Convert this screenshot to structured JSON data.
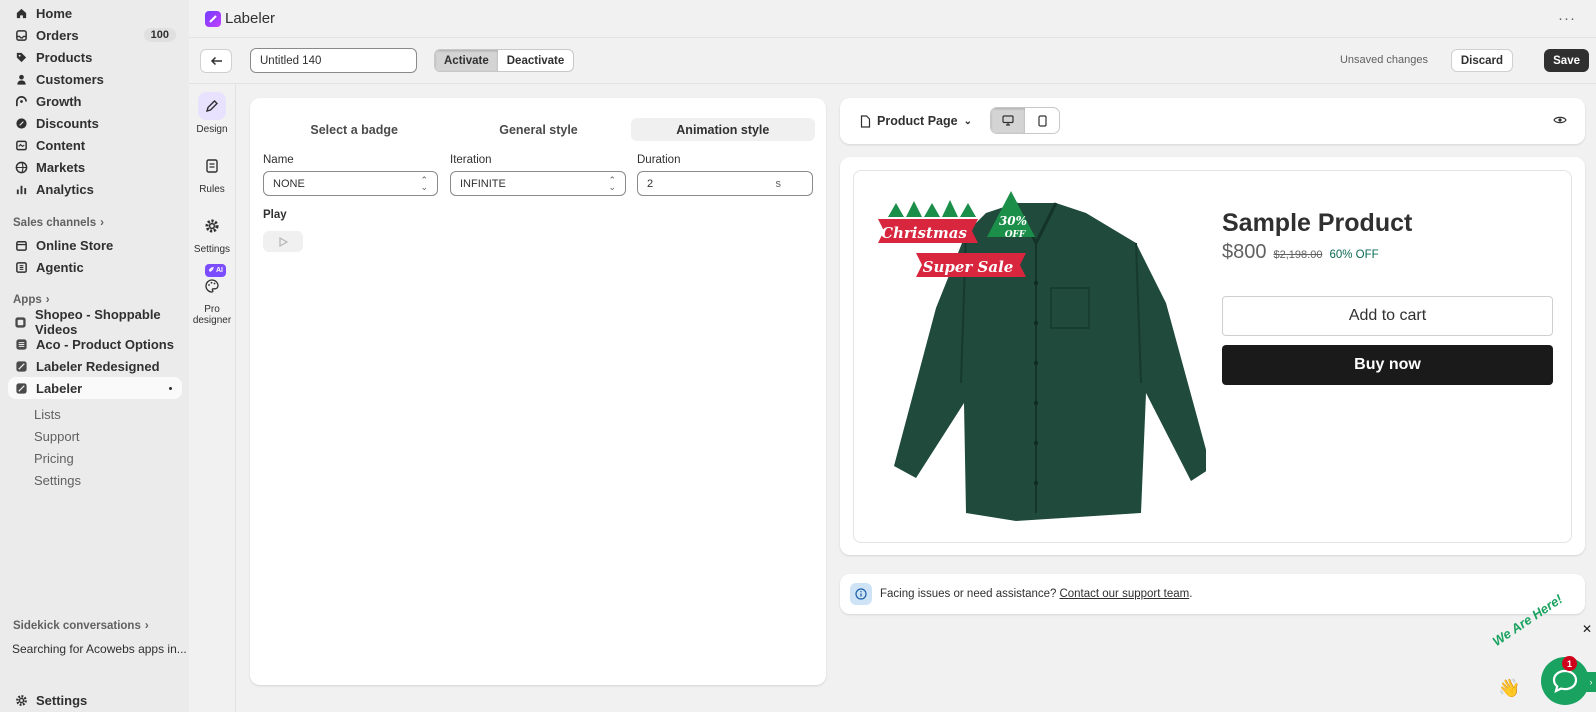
{
  "sidebar": {
    "items": [
      {
        "label": "Home",
        "icon": "home-icon"
      },
      {
        "label": "Orders",
        "icon": "inbox-icon",
        "badge": "100"
      },
      {
        "label": "Products",
        "icon": "tag-icon"
      },
      {
        "label": "Customers",
        "icon": "person-icon"
      },
      {
        "label": "Growth",
        "icon": "growth-icon"
      },
      {
        "label": "Discounts",
        "icon": "discount-icon"
      },
      {
        "label": "Content",
        "icon": "content-icon"
      },
      {
        "label": "Markets",
        "icon": "globe-icon"
      },
      {
        "label": "Analytics",
        "icon": "analytics-icon"
      }
    ],
    "sales_channels_title": "Sales channels",
    "sales_channels": [
      {
        "label": "Online Store",
        "icon": "store-icon"
      },
      {
        "label": "Agentic",
        "icon": "agentic-icon"
      }
    ],
    "apps_title": "Apps",
    "apps": [
      {
        "label": "Shopeo - Shoppable Videos",
        "icon": "app-icon"
      },
      {
        "label": "Aco - Product Options",
        "icon": "app-icon"
      },
      {
        "label": "Labeler Redesigned",
        "icon": "app-icon"
      },
      {
        "label": "Labeler",
        "icon": "labeler-icon"
      }
    ],
    "labeler_sub": [
      "Lists",
      "Support",
      "Pricing",
      "Settings"
    ],
    "sidekick_title": "Sidekick conversations",
    "sidekick_item": "Searching for Acowebs apps in...",
    "settings_label": "Settings"
  },
  "topbar": {
    "app_name": "Labeler"
  },
  "toolbar": {
    "title_value": "Untitled 140",
    "activate_label": "Activate",
    "deactivate_label": "Deactivate",
    "unsaved_text": "Unsaved changes",
    "discard_label": "Discard",
    "save_label": "Save"
  },
  "tools": [
    {
      "label": "Design",
      "icon": "pencil-icon"
    },
    {
      "label": "Rules",
      "icon": "scroll-icon"
    },
    {
      "label": "Settings",
      "icon": "gear-icon"
    },
    {
      "label": "Pro designer",
      "icon": "palette-icon",
      "tag": "AI"
    }
  ],
  "editor": {
    "tabs": [
      "Select a badge",
      "General style",
      "Animation style"
    ],
    "active_tab": "Animation style",
    "name_label": "Name",
    "name_value": "NONE",
    "iteration_label": "Iteration",
    "iteration_value": "INFINITE",
    "duration_label": "Duration",
    "duration_value": "2",
    "duration_unit": "s",
    "play_label": "Play"
  },
  "preview": {
    "page_select": "Product Page",
    "badge": {
      "line1": "Christmas",
      "line2": "Super Sale",
      "pct": "30%",
      "off": "OFF"
    },
    "product_title": "Sample Product",
    "price": "$800",
    "compare_price": "$2,198.00",
    "discount": "60% OFF",
    "add_to_cart": "Add to cart",
    "buy_now": "Buy now"
  },
  "help": {
    "text": "Facing issues or need assistance?",
    "link": "Contact our support team",
    "tail": "."
  },
  "chat": {
    "text": "We Are Here!",
    "count": "1",
    "close": "✕"
  }
}
